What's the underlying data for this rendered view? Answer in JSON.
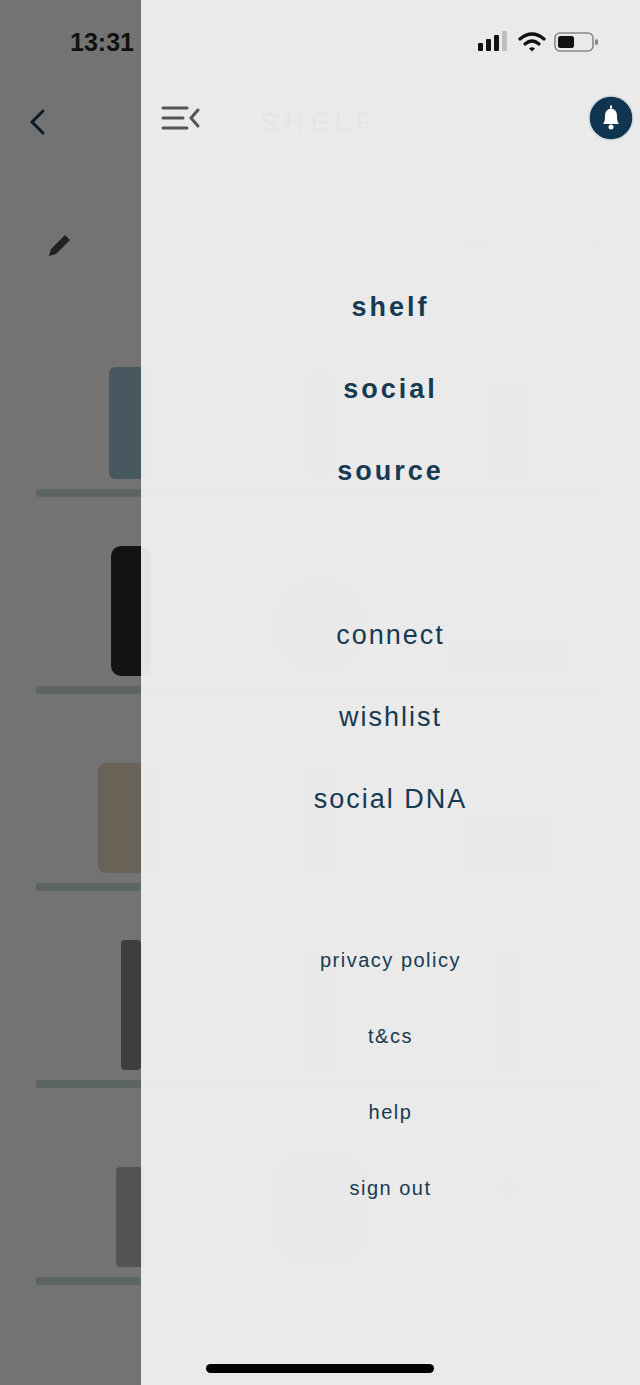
{
  "status_bar": {
    "time": "13:31",
    "signal_level": 0.75,
    "battery_level": 0.5
  },
  "page": {
    "title": "SHELF",
    "filter": {
      "placeholder": "filter"
    },
    "add_button": "+"
  },
  "menu": {
    "groups": [
      {
        "kind": "primary",
        "items": [
          {
            "label": "shelf"
          },
          {
            "label": "social"
          },
          {
            "label": "source"
          }
        ]
      },
      {
        "kind": "secondary",
        "items": [
          {
            "label": "connect"
          },
          {
            "label": "wishlist"
          },
          {
            "label": "social DNA"
          }
        ]
      },
      {
        "kind": "footer",
        "items": [
          {
            "label": "privacy policy"
          },
          {
            "label": "t&cs"
          },
          {
            "label": "help"
          },
          {
            "label": "sign out"
          }
        ]
      }
    ]
  }
}
